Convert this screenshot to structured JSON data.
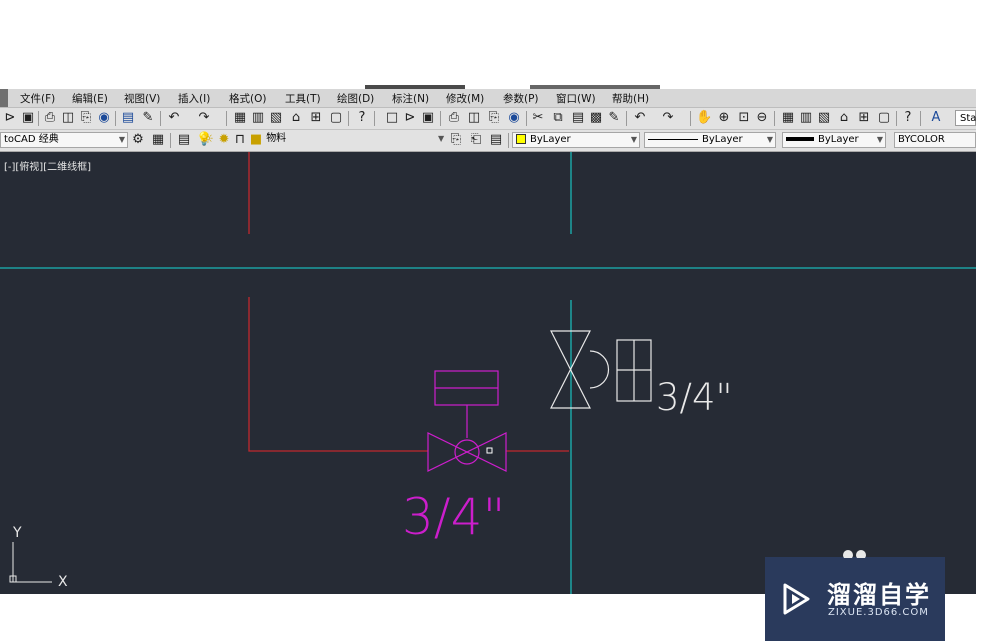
{
  "menu": [
    "文件(F)",
    "编辑(E)",
    "视图(V)",
    "插入(I)",
    "格式(O)",
    "工具(T)",
    "绘图(D)",
    "标注(N)",
    "修改(M)",
    "参数(P)",
    "窗口(W)",
    "帮助(H)"
  ],
  "toolbar": {
    "text_style_value": "Sta"
  },
  "properties_bar": {
    "workspace": "toCAD 经典",
    "layer": "物料",
    "color": "ByLayer",
    "linetype": "ByLayer",
    "lineweight": "ByLayer",
    "plotstyle": "BYCOLOR"
  },
  "viewport": {
    "label": "[-][俯视][二维线框]",
    "ucs_y": "Y",
    "ucs_x": "X"
  },
  "annotations": {
    "size_upper": "3/4\"",
    "size_lower": "3/4\""
  },
  "colors": {
    "background": "#262b35",
    "red_line": "#c0282e",
    "cyan_line": "#1ab6b6",
    "magenta": "#cc1ecc",
    "white": "#e8e8e8"
  },
  "watermark": {
    "title": "溜溜自学",
    "url": "ZIXUE.3D66.COM"
  }
}
